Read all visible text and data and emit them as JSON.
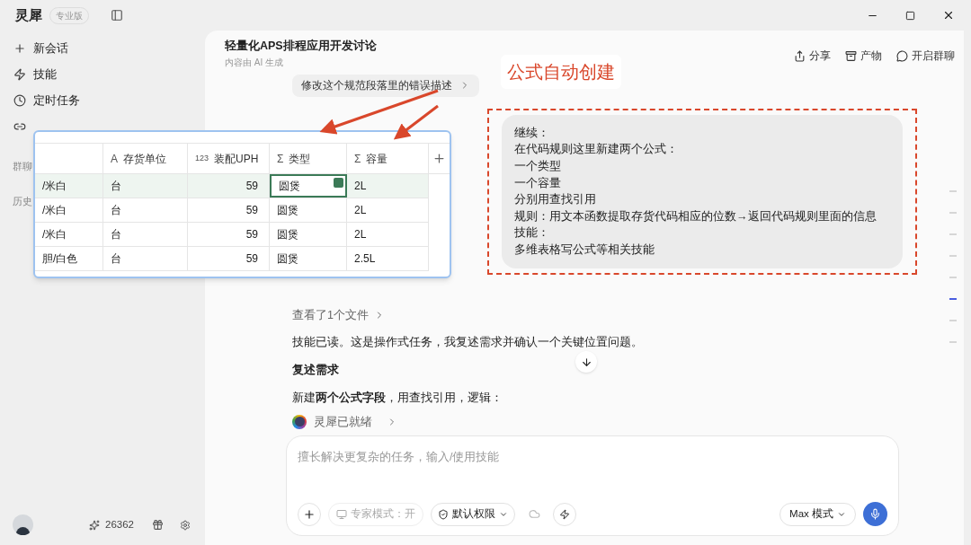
{
  "app": {
    "name": "灵犀",
    "edition": "专业版"
  },
  "sidebar": {
    "items": [
      {
        "kind": "new",
        "label": "新会话"
      },
      {
        "kind": "skill",
        "label": "技能"
      },
      {
        "kind": "schedule",
        "label": "定时任务"
      },
      {
        "kind": "channel"
      }
    ],
    "sections": [
      "群聊",
      "历史"
    ],
    "footer": {
      "credits": "26362"
    }
  },
  "header": {
    "title": "轻量化APS排程应用开发讨论",
    "subtitle": "内容由 AI 生成",
    "actions": [
      {
        "kind": "share",
        "label": "分享"
      },
      {
        "kind": "artifact",
        "label": "产物"
      },
      {
        "kind": "group",
        "label": "开启群聊"
      }
    ]
  },
  "suggestion": "修改这个规范段落里的错误描述",
  "annotation": "公式自动创建",
  "user_message": [
    "继续：",
    "在代码规则这里新建两个公式：",
    "一个类型",
    "一个容量",
    "分别用查找引用",
    "规则：用文本函数提取存货代码相应的位数→返回代码规则里面的信息",
    "技能：",
    "多维表格写公式等相关技能"
  ],
  "files_viewed": "查看了1个文件",
  "reply": [
    {
      "kind": "text",
      "text": "技能已读。这是操作式任务，我复述需求并确认一个关键位置问题。"
    },
    {
      "kind": "heading",
      "text": "复述需求"
    },
    {
      "kind": "text",
      "text": "新建**两个公式字段**，用查找引用，逻辑："
    }
  ],
  "status": "灵犀已就绪",
  "composer": {
    "placeholder": "擅长解决更复杂的任务，输入/使用技能",
    "expert_mode": {
      "label": "专家模式：开",
      "disabled": true
    },
    "permission": "默认权限",
    "model": "Max 模式"
  },
  "outline_markers": [
    {
      "selected": false
    },
    {
      "selected": false
    },
    {
      "selected": false
    },
    {
      "selected": false
    },
    {
      "selected": false
    },
    {
      "selected": true
    },
    {
      "selected": false
    },
    {
      "selected": false
    }
  ],
  "spreadsheet": {
    "columns": [
      {
        "kind": "blank"
      },
      {
        "kind": "text",
        "type_mark": "A",
        "label": "存货单位"
      },
      {
        "kind": "number",
        "type_mark": "123",
        "label": "装配UPH"
      },
      {
        "kind": "formula",
        "type_mark": "Σ",
        "label": "类型"
      },
      {
        "kind": "formula",
        "type_mark": "Σ",
        "label": "容量"
      }
    ],
    "rows": [
      {
        "selected": true,
        "cells": [
          {
            "text": "/米白",
            "active": false
          },
          {
            "text": "台",
            "active": false
          },
          {
            "text": "59",
            "active": false
          },
          {
            "text": "圆煲",
            "active": true
          },
          {
            "text": "2L",
            "active": false
          }
        ]
      },
      {
        "selected": false,
        "cells": [
          {
            "text": "/米白",
            "active": false
          },
          {
            "text": "台",
            "active": false
          },
          {
            "text": "59",
            "active": false
          },
          {
            "text": "圆煲",
            "active": false
          },
          {
            "text": "2L",
            "active": false
          }
        ]
      },
      {
        "selected": false,
        "cells": [
          {
            "text": "/米白",
            "active": false
          },
          {
            "text": "台",
            "active": false
          },
          {
            "text": "59",
            "active": false
          },
          {
            "text": "圆煲",
            "active": false
          },
          {
            "text": "2L",
            "active": false
          }
        ]
      },
      {
        "selected": false,
        "cells": [
          {
            "text": "胆/白色",
            "active": false
          },
          {
            "text": "台",
            "active": false
          },
          {
            "text": "59",
            "active": false
          },
          {
            "text": "圆煲",
            "active": false
          },
          {
            "text": "2.5L",
            "active": false
          }
        ]
      }
    ]
  }
}
